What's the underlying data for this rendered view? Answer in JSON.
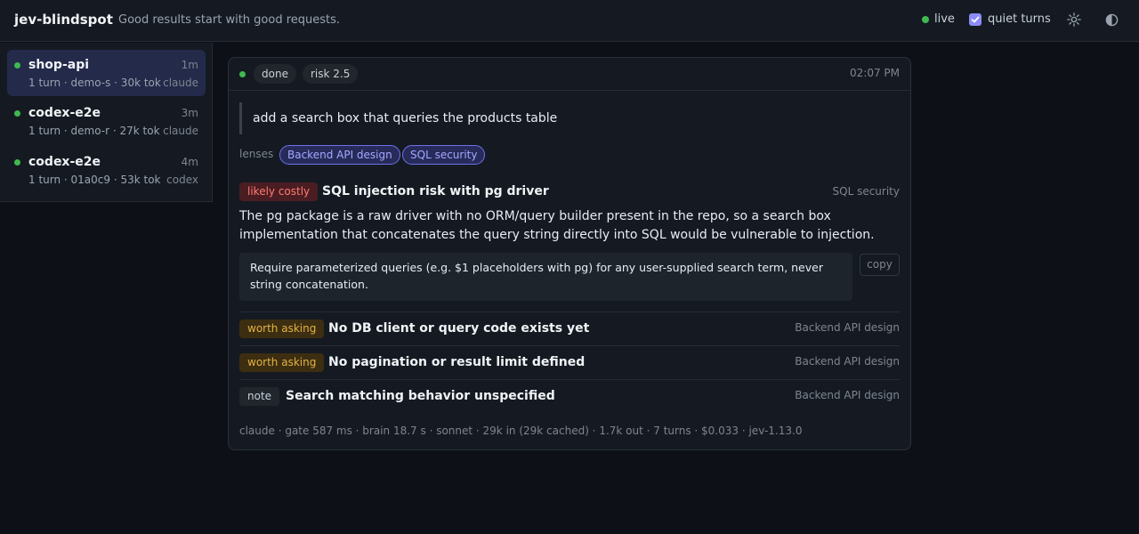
{
  "header": {
    "app_name": "jev-blindspot",
    "tagline": "Good results start with good requests.",
    "live_label": "live",
    "quiet_label": "quiet turns",
    "quiet_checked": true
  },
  "sessions": [
    {
      "name": "shop-api",
      "age": "1m",
      "meta": "1 turn · demo-s · 30k tok",
      "agent": "claude",
      "active": true
    },
    {
      "name": "codex-e2e",
      "age": "3m",
      "meta": "1 turn · demo-r · 27k tok",
      "agent": "claude",
      "active": false
    },
    {
      "name": "codex-e2e",
      "age": "4m",
      "meta": "1 turn · 01a0c9 · 53k tok",
      "agent": "codex",
      "active": false
    }
  ],
  "card": {
    "status": "done",
    "risk": "risk 2.5",
    "time": "02:07 PM",
    "prompt": "add a search box that queries the products table",
    "lenses_label": "lenses",
    "lenses": [
      "Backend API design",
      "SQL security"
    ],
    "findings": [
      {
        "severity": "likely costly",
        "title": "SQL injection risk with pg driver",
        "lens": "SQL security",
        "body": "The pg package is a raw driver with no ORM/query builder present in the repo, so a search box implementation that concatenates the query string directly into SQL would be vulnerable to injection.",
        "suggestion": "Require parameterized queries (e.g. $1 placeholders with pg) for any user-supplied search term, never string concatenation.",
        "copy_label": "copy"
      },
      {
        "severity": "worth asking",
        "title": "No DB client or query code exists yet",
        "lens": "Backend API design"
      },
      {
        "severity": "worth asking",
        "title": "No pagination or result limit defined",
        "lens": "Backend API design"
      },
      {
        "severity": "note",
        "title": "Search matching behavior unspecified",
        "lens": "Backend API design"
      }
    ],
    "footer": "claude · gate 587 ms · brain 18.7 s · sonnet · 29k in (29k cached) · 1.7k out · 7 turns · $0.033 · jev-1.13.0"
  },
  "colors": {
    "status_green": "#3fb950",
    "accent": "#8b8cf8",
    "costly": "#ff7b72",
    "asking": "#e3b341"
  },
  "icons": [
    "status-dot-icon",
    "checkbox-check-icon",
    "gear-icon",
    "contrast-icon"
  ]
}
